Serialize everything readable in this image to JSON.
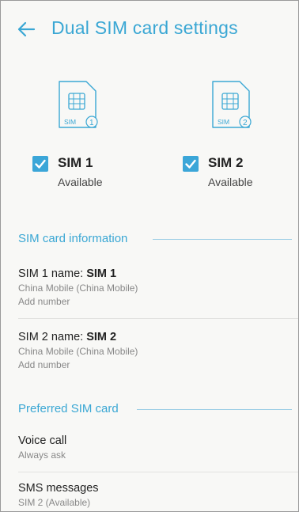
{
  "header": {
    "title": "Dual SIM card settings"
  },
  "sims": [
    {
      "badge": "SIM",
      "number": "1",
      "name": "SIM 1",
      "status": "Available",
      "checked": true
    },
    {
      "badge": "SIM",
      "number": "2",
      "name": "SIM 2",
      "status": "Available",
      "checked": true
    }
  ],
  "sim_info": {
    "header": "SIM card information",
    "items": [
      {
        "label": "SIM 1 name:",
        "value": "SIM 1",
        "carrier": "China Mobile (China Mobile)",
        "action": "Add number"
      },
      {
        "label": "SIM 2 name:",
        "value": "SIM 2",
        "carrier": "China Mobile (China Mobile)",
        "action": "Add number"
      }
    ]
  },
  "preferred": {
    "header": "Preferred SIM card",
    "items": [
      {
        "title": "Voice call",
        "sub": "Always ask"
      },
      {
        "title": "SMS messages",
        "sub": "SIM 2 (Available)"
      }
    ]
  },
  "colors": {
    "accent": "#3aa7d4",
    "checkbox": "#3ba6d8",
    "background": "#f8f8f6"
  }
}
